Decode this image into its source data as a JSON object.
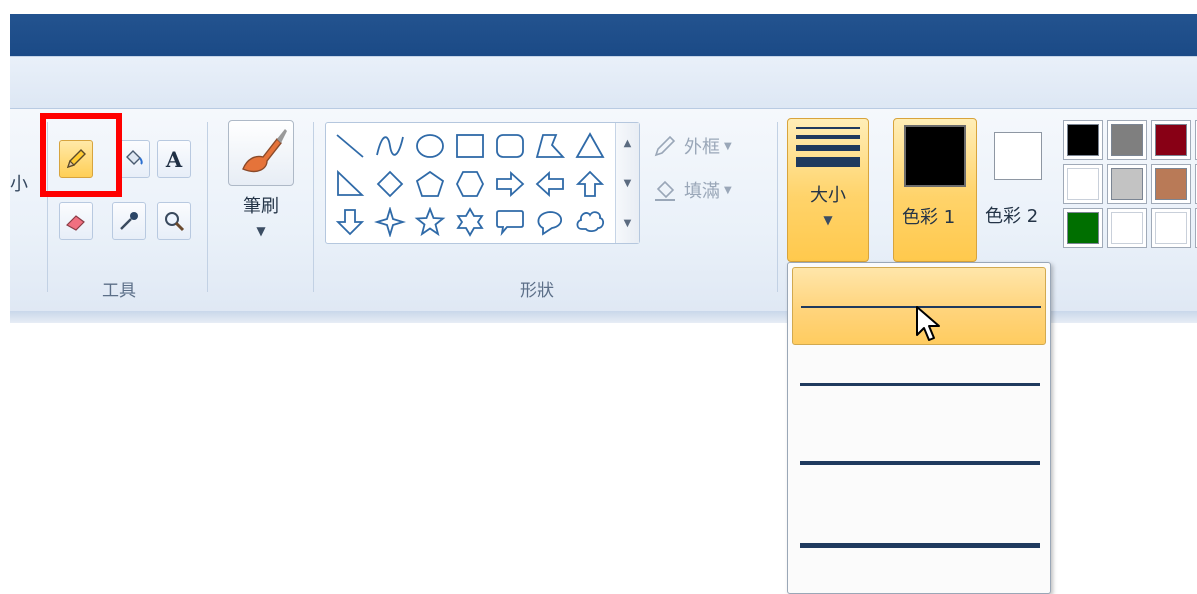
{
  "ribbon": {
    "cut_label": "小",
    "tools": {
      "group_label": "工具",
      "items": [
        "pencil-icon",
        "fill-icon",
        "text-icon",
        "eraser-icon",
        "color-picker-icon",
        "magnifier-icon"
      ],
      "active": "pencil-icon"
    },
    "brushes": {
      "label": "筆刷"
    },
    "shapes": {
      "group_label": "形狀",
      "outline_label": "外框",
      "fill_label": "填滿"
    },
    "size": {
      "label": "大小"
    },
    "color1": {
      "label": "色彩 1",
      "value": "#000000"
    },
    "color2": {
      "label": "色彩 2",
      "value": "#ffffff"
    },
    "palette": [
      "#000000",
      "#7f7f7f",
      "#880015",
      "#ffffff",
      "#ffffff",
      "#c3c3c3",
      "#b97a57",
      "#ffffff",
      "#006f00",
      "#ffffff",
      "#ffffff",
      "#ffffff"
    ]
  },
  "size_dropdown": {
    "options": [
      "1px",
      "3px",
      "5px",
      "8px"
    ],
    "selected_index": 0
  },
  "colors": {
    "highlight": "#ffd36a",
    "title_bar": "#1f4d8a",
    "annotation_box": "#ff0000"
  }
}
